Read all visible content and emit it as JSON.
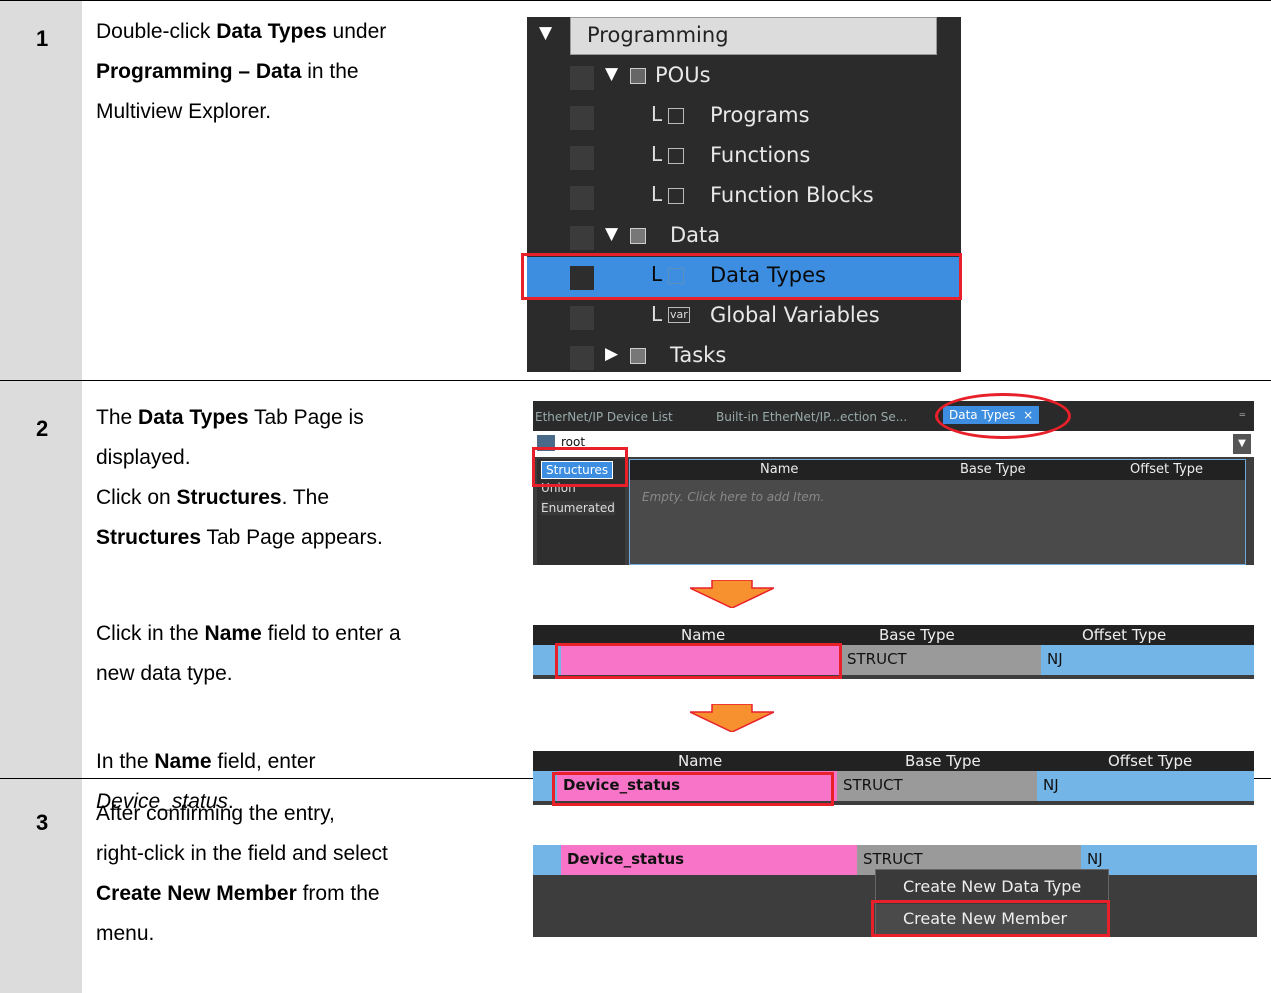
{
  "steps": [
    {
      "number": "1",
      "lines": [
        {
          "parts": [
            {
              "t": "Double-click "
            },
            {
              "t": "Data Types",
              "b": true
            },
            {
              "t": " under"
            }
          ]
        },
        {
          "parts": [
            {
              "t": "Programming – Data",
              "b": true
            },
            {
              "t": " in the"
            }
          ]
        },
        {
          "parts": [
            {
              "t": "Multiview Explorer."
            }
          ]
        }
      ]
    },
    {
      "number": "2",
      "lines": [
        {
          "parts": [
            {
              "t": "The "
            },
            {
              "t": "Data Types",
              "b": true
            },
            {
              "t": " Tab Page is"
            }
          ]
        },
        {
          "parts": [
            {
              "t": "displayed."
            }
          ]
        },
        {
          "parts": [
            {
              "t": "Click on "
            },
            {
              "t": "Structures",
              "b": true
            },
            {
              "t": ". The"
            }
          ]
        },
        {
          "parts": [
            {
              "t": "Structures",
              "b": true
            },
            {
              "t": " Tab Page appears."
            }
          ]
        }
      ],
      "lines_b": [
        {
          "parts": [
            {
              "t": "Click in the "
            },
            {
              "t": "Name",
              "b": true
            },
            {
              "t": " field to enter a"
            }
          ]
        },
        {
          "parts": [
            {
              "t": "new data type."
            }
          ]
        }
      ],
      "lines_c": [
        {
          "parts": [
            {
              "t": "In the "
            },
            {
              "t": "Name",
              "b": true
            },
            {
              "t": " field, enter"
            }
          ]
        },
        {
          "parts": [
            {
              "t": "Device_status",
              "i": true
            },
            {
              "t": "."
            }
          ]
        }
      ]
    },
    {
      "number": "3",
      "lines": [
        {
          "parts": [
            {
              "t": "After confirming the entry,"
            }
          ]
        },
        {
          "parts": [
            {
              "t": "right-click in the field and select"
            }
          ]
        },
        {
          "parts": [
            {
              "t": "Create New Member",
              "b": true
            },
            {
              "t": " from the"
            }
          ]
        },
        {
          "parts": [
            {
              "t": "menu."
            }
          ]
        }
      ]
    }
  ],
  "explorer": {
    "programming": "Programming",
    "pous": "POUs",
    "programs": "Programs",
    "functions": "Functions",
    "function_blocks": "Function Blocks",
    "data": "Data",
    "data_types": "Data Types",
    "global_variables": "Global Variables",
    "tasks": "Tasks",
    "var_icon_text": "var",
    "l_mark": "L"
  },
  "datatypes_page": {
    "tabs": [
      "EtherNet/IP Device List",
      "Built-in EtherNet/IP...ection Se...",
      "Data Types"
    ],
    "close_glyph": "×",
    "root": "root",
    "left_items": [
      "Structures",
      "Union",
      "Enumerated"
    ],
    "empty_text": "Empty. Click here to add Item."
  },
  "grid": {
    "columns": [
      "Name",
      "Base Type",
      "Offset Type"
    ],
    "base_type_value": "STRUCT",
    "offset_type_value": "NJ",
    "name_value": "Device_status"
  },
  "context_menu": {
    "items": [
      "Create New Data Type",
      "Create New Member"
    ]
  },
  "colors": {
    "highlight_red": "#e8202a",
    "selection_blue": "#3d8ee0",
    "name_pink": "#f874c8",
    "arrow_orange": "#f7912f"
  }
}
